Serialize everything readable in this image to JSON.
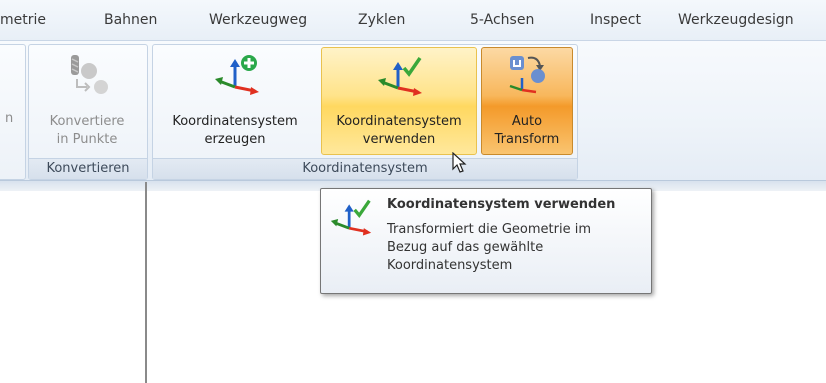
{
  "tabs": [
    {
      "label": "metrie"
    },
    {
      "label": "Bahnen"
    },
    {
      "label": "Werkzeugweg"
    },
    {
      "label": "Zyklen"
    },
    {
      "label": "5-Achsen"
    },
    {
      "label": "Inspect"
    },
    {
      "label": "Werkzeugdesign"
    }
  ],
  "ribbon": {
    "partial_left_label": "n",
    "groups": {
      "konvertieren": {
        "label": "Konvertieren",
        "button": {
          "line1": "Konvertiere",
          "line2": "in Punkte",
          "enabled": false
        }
      },
      "koordinatensystem": {
        "label": "Koordinatensystem",
        "buttons": [
          {
            "line1": "Koordinatensystem",
            "line2": "erzeugen",
            "state": "normal"
          },
          {
            "line1": "Koordinatensystem",
            "line2": "verwenden",
            "state": "hover"
          },
          {
            "line1": "Auto",
            "line2": "Transform",
            "state": "pressed"
          }
        ]
      }
    }
  },
  "tooltip": {
    "title": "Koordinatensystem verwenden",
    "description_lines": [
      "Transformiert die Geometrie im",
      "Bezug auf das gewählte",
      "Koordinatensystem"
    ]
  },
  "colors": {
    "axis_x": "#e03020",
    "axis_y": "#2a8a2a",
    "axis_z": "#2060c8",
    "check": "#3aa83a"
  }
}
